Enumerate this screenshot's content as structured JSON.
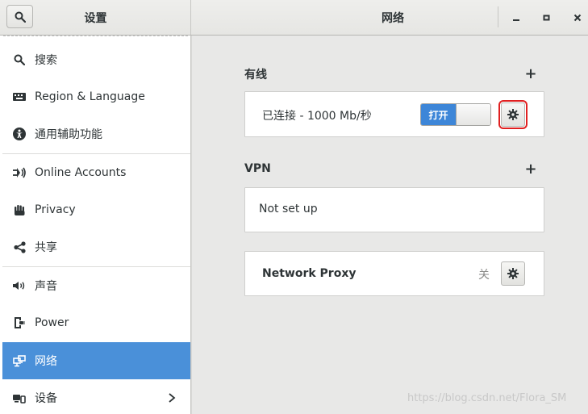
{
  "header": {
    "left_title": "设置",
    "right_title": "网络",
    "minimize_label": "–",
    "maximize_label": "□",
    "close_label": "×"
  },
  "icons": {
    "search_toggle": "search-icon",
    "minimize": "minimize-icon",
    "maximize": "maximize-icon",
    "close": "close-icon",
    "gear": "gear-icon"
  },
  "sidebar": {
    "items": [
      {
        "label": "搜索",
        "icon": "search-icon"
      },
      {
        "label": "Region & Language",
        "icon": "keyboard-icon"
      },
      {
        "label": "通用辅助功能",
        "icon": "accessibility-icon"
      },
      {
        "label": "Online Accounts",
        "icon": "online-accounts-icon"
      },
      {
        "label": "Privacy",
        "icon": "hand-icon"
      },
      {
        "label": "共享",
        "icon": "share-icon"
      },
      {
        "label": "声音",
        "icon": "speaker-icon"
      },
      {
        "label": "Power",
        "icon": "power-icon"
      },
      {
        "label": "网络",
        "icon": "network-icon",
        "selected": true
      },
      {
        "label": "设备",
        "icon": "devices-icon",
        "has_chevron": true
      }
    ]
  },
  "wired": {
    "title": "有线",
    "add_label": "+",
    "status": "已连接 - 1000 Mb/秒",
    "toggle_label": "打开",
    "toggle_on": true
  },
  "vpn": {
    "title": "VPN",
    "add_label": "+",
    "status": "Not set up"
  },
  "proxy": {
    "label": "Network Proxy",
    "state": "关"
  },
  "watermark": "https://blog.csdn.net/Flora_SM",
  "colors": {
    "accent": "#4a90d9",
    "toggle_on": "#3d86d8",
    "highlight": "#e02020"
  }
}
